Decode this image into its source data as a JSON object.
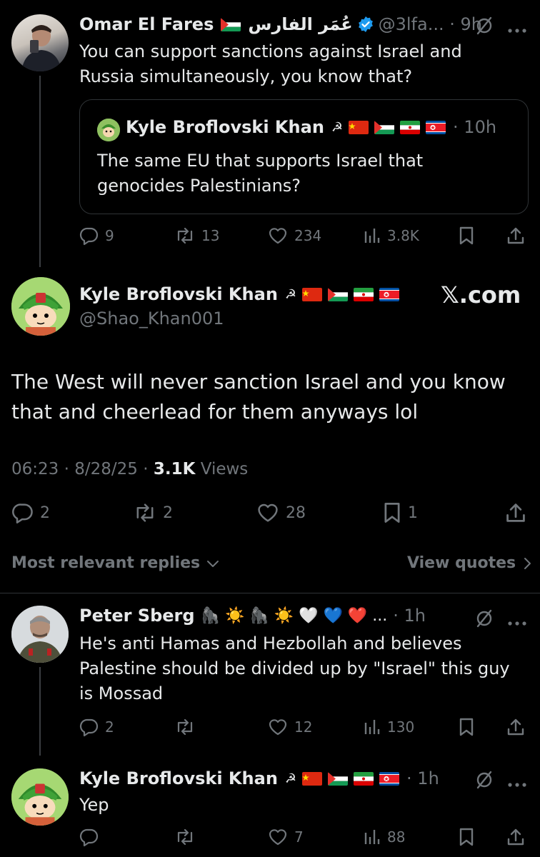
{
  "tweet1": {
    "name": "Omar El Fares",
    "arabic_name": "عُمَر الفارس",
    "handle_time": "@3lfa... · 9h",
    "text_line1": "You can support sanctions against Israel and",
    "text_line2": "Russia simultaneously, you know that?",
    "quote": {
      "name": "Kyle Broflovski Khan",
      "time": "· 10h",
      "text_line1": "The same EU that supports Israel that",
      "text_line2": "genocides Palestinians?"
    },
    "stats": {
      "replies": "9",
      "reposts": "13",
      "likes": "234",
      "views": "3.8K"
    }
  },
  "main_tweet": {
    "name": "Kyle Broflovski Khan",
    "handle": "@Shao_Khan001",
    "watermark": "𝕏.com",
    "text_line1": "The West will never sanction Israel and you know",
    "text_line2": "that and cheerlead for them anyways lol",
    "time_date": "06:23 · 8/28/25 · ",
    "views_count": "3.1K",
    "views_label": " Views",
    "stats": {
      "replies": "2",
      "reposts": "2",
      "likes": "28",
      "bookmarks": "1"
    }
  },
  "replies_bar": {
    "sort_label": "Most relevant replies",
    "quotes_label": "View quotes"
  },
  "reply1": {
    "name": "Peter Sberg",
    "emojis": "🦍 ☀️ 🦍 ☀️ 🤍 💙 ❤️ ...",
    "time": "· 1h",
    "text_line1": "He's anti Hamas and Hezbollah and believes",
    "text_line2": "Palestine should be divided up by \"Israel\" this guy",
    "text_line3": "is Mossad",
    "stats": {
      "replies": "2",
      "reposts": "",
      "likes": "12",
      "views": "130"
    }
  },
  "reply2": {
    "name": "Kyle Broflovski Khan",
    "time": "· 1h",
    "text": "Yep",
    "stats": {
      "replies": "",
      "reposts": "",
      "likes": "7",
      "views": "88"
    }
  },
  "colors": {
    "background": "#000000",
    "text": "#e7e9ea",
    "muted": "#71767b",
    "verified": "#1d9bf0",
    "divider": "#2f3336"
  }
}
